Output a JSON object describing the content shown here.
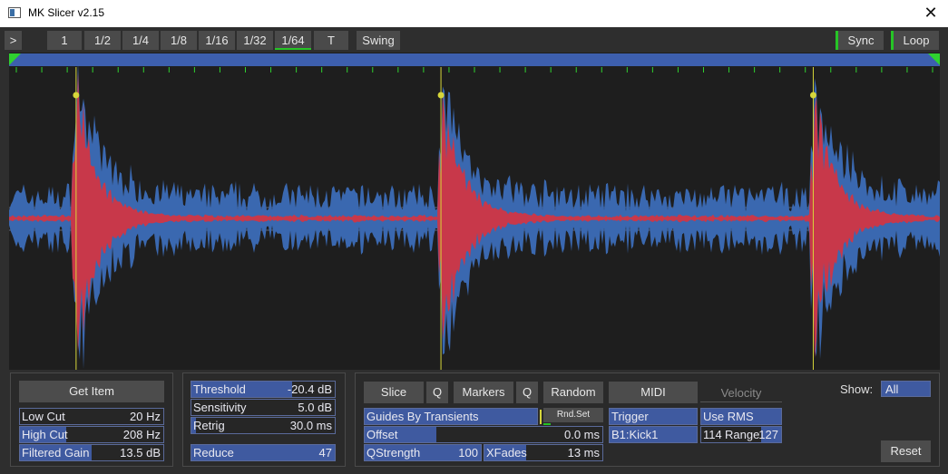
{
  "window": {
    "title": "MK Slicer v2.15",
    "close_glyph": "✕"
  },
  "toolbar": {
    "expand_label": ">",
    "grid_buttons": [
      "1",
      "1/2",
      "1/4",
      "1/8",
      "1/16",
      "1/32",
      "1/64",
      "T"
    ],
    "active_grid": "1/64",
    "swing_label": "Swing",
    "sync_label": "Sync",
    "loop_label": "Loop"
  },
  "colors": {
    "background": "#2e2e2e",
    "wave_bg": "#1e1e1e",
    "wave_blue": "#3a68b0",
    "wave_red": "#c8384a",
    "slice_line": "#d6d63a",
    "grid_green": "#2fd12f",
    "field_fill": "#3f5aa0"
  },
  "filter_panel": {
    "get_item_label": "Get Item",
    "low_cut": {
      "label": "Low Cut",
      "value": "20 Hz",
      "level": 0.0
    },
    "high_cut": {
      "label": "High Cut",
      "value": "208 Hz",
      "level": 0.32
    },
    "filtered_gain": {
      "label": "Filtered Gain",
      "value": "13.5 dB",
      "level": 0.5
    }
  },
  "detect_panel": {
    "threshold": {
      "label": "Threshold",
      "value": "-20.4 dB",
      "level": 0.7
    },
    "sensitivity": {
      "label": "Sensitivity",
      "value": "5.0 dB",
      "level": 0.0
    },
    "retrig": {
      "label": "Retrig",
      "value": "30.0 ms",
      "level": 0.03
    },
    "reduce": {
      "label": "Reduce",
      "value": "47",
      "level": 1.0
    }
  },
  "action_panel": {
    "slice_label": "Slice",
    "q_label": "Q",
    "markers_label": "Markers",
    "random_label": "Random",
    "midi_label": "MIDI",
    "velocity_label": "Velocity",
    "show_label": "Show:",
    "show_value": "All",
    "guides": {
      "label": "Guides By Transients",
      "level": 1.0
    },
    "rnd_set_label": "Rnd.Set",
    "offset": {
      "label": "Offset",
      "value": "0.0 ms",
      "level": 0.3
    },
    "qstrength": {
      "label": "QStrength",
      "value": "100",
      "level": 1.0
    },
    "xfades": {
      "label": "XFades",
      "value": "13 ms",
      "level": 0.35
    },
    "trigger_label": "Trigger",
    "note_label": "B1:Kick1",
    "use_rms_label": "Use RMS",
    "range_low": "114",
    "range_label": "Range",
    "range_high": "127",
    "reset_label": "Reset"
  },
  "waveform": {
    "slice_positions": [
      0.072,
      0.464,
      0.864
    ],
    "grid_tick_count": 37
  }
}
